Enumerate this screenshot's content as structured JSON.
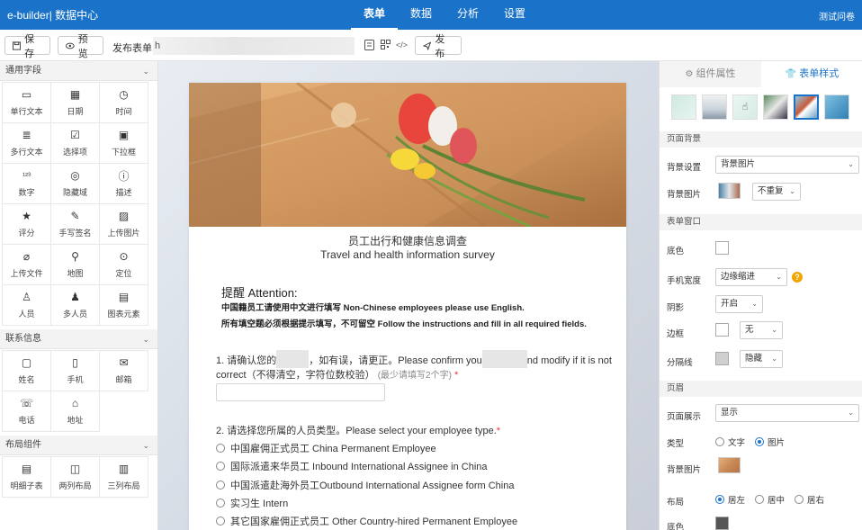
{
  "topbar": {
    "brand": "e-builder| 数据中心",
    "nav": [
      "表单",
      "数据",
      "分析",
      "设置"
    ],
    "active_nav": "表单",
    "user": "测试问卷"
  },
  "toolbar": {
    "save": "保存",
    "preview": "预览",
    "publish_label": "发布表单",
    "url_value": "h",
    "publish": "发布"
  },
  "palette": {
    "common": {
      "title": "通用字段",
      "items": [
        {
          "label": "单行文本",
          "icon": "single-line-icon"
        },
        {
          "label": "日期",
          "icon": "calendar-icon"
        },
        {
          "label": "时间",
          "icon": "clock-icon"
        },
        {
          "label": "多行文本",
          "icon": "multi-line-icon"
        },
        {
          "label": "选择项",
          "icon": "checklist-icon"
        },
        {
          "label": "下拉框",
          "icon": "dropdown-icon"
        },
        {
          "label": "数字",
          "icon": "number-icon"
        },
        {
          "label": "隐藏域",
          "icon": "eye-off-icon"
        },
        {
          "label": "描述",
          "icon": "info-icon"
        },
        {
          "label": "评分",
          "icon": "star-icon"
        },
        {
          "label": "手写签名",
          "icon": "pen-icon"
        },
        {
          "label": "上传图片",
          "icon": "image-icon"
        },
        {
          "label": "上传文件",
          "icon": "paperclip-icon"
        },
        {
          "label": "地图",
          "icon": "map-pin-icon"
        },
        {
          "label": "定位",
          "icon": "location-icon"
        },
        {
          "label": "人员",
          "icon": "person-icon"
        },
        {
          "label": "多人员",
          "icon": "people-icon"
        },
        {
          "label": "图表元素",
          "icon": "chart-icon"
        }
      ]
    },
    "contact": {
      "title": "联系信息",
      "items": [
        {
          "label": "姓名",
          "icon": "name-card-icon"
        },
        {
          "label": "手机",
          "icon": "phone-icon"
        },
        {
          "label": "邮箱",
          "icon": "mail-icon"
        },
        {
          "label": "电话",
          "icon": "telephone-icon"
        },
        {
          "label": "地址",
          "icon": "home-icon"
        }
      ]
    },
    "layout": {
      "title": "布局组件",
      "items": [
        {
          "label": "明细子表",
          "icon": "subtable-icon"
        },
        {
          "label": "两列布局",
          "icon": "two-column-icon"
        },
        {
          "label": "三列布局",
          "icon": "three-column-icon"
        }
      ]
    }
  },
  "form": {
    "title_cn": "员工出行和健康信息调查",
    "title_en": "Travel and health information survey",
    "notice_title": "提醒 Attention:",
    "notice_line1": "中国籍员工请使用中文进行填写 Non-Chinese employees please use English.",
    "notice_line2": "所有填空题必须根据提示填写，不可留空 Follow the instructions and fill in all required fields.",
    "q1_part1": "1. 请确认您的",
    "q1_part2": "，如有误，请更正。Please confirm you",
    "q1_part3": "nd modify if it is not",
    "q1_line2": "correct（不得清空，字符位数校验）",
    "q1_hint": "(最少请填写2个字)",
    "required_mark": "*",
    "q2": "2. 请选择您所属的人员类型。Please select your employee type.",
    "q2_options": [
      "中国雇佣正式员工 China Permanent Employee",
      "国际派遣来华员工 Inbound International Assignee in China",
      "中国派遣赴海外员工Outbound International Assignee form China",
      "实习生 Intern",
      "其它国家雇佣正式员工 Other Country-hired Permanent Employee"
    ]
  },
  "right_panel": {
    "tab_component": "组件属性",
    "tab_style": "表单样式",
    "section_page_bg": "页面背景",
    "bg_setting_label": "背景设置",
    "bg_setting_value": "背景图片",
    "bg_image_label": "背景图片",
    "bg_repeat_value": "不重复",
    "section_form_window": "表单窗口",
    "color_label": "底色",
    "mobile_width_label": "手机宽度",
    "mobile_width_value": "边缘缩进",
    "shadow_label": "阴影",
    "shadow_value": "开启",
    "border_label": "边框",
    "border_value": "无",
    "divider_label": "分隔线",
    "divider_value": "隐藏",
    "section_header": "页眉",
    "header_display_label": "页面展示",
    "header_display_value": "显示",
    "type_label": "类型",
    "type_options": [
      "文字",
      "图片"
    ],
    "type_selected": "图片",
    "header_bg_label": "背景图片",
    "layout_label": "布局",
    "layout_options": [
      "居左",
      "居中",
      "居右"
    ],
    "layout_selected": "居左",
    "bottom_color_label": "底色"
  }
}
